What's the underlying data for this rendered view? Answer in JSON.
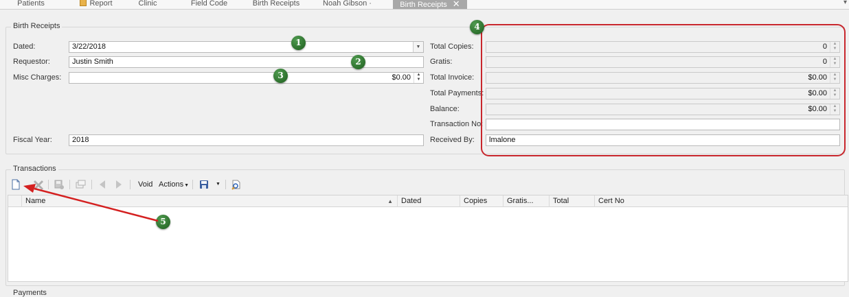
{
  "tabs": [
    {
      "label": "Patients",
      "icon": null,
      "active": false
    },
    {
      "label": "Report",
      "icon": "report-icon",
      "active": false
    },
    {
      "label": "Clinic",
      "icon": null,
      "active": false
    },
    {
      "label": "Field Code",
      "icon": null,
      "active": false
    },
    {
      "label": "Birth Receipts",
      "icon": null,
      "active": false
    },
    {
      "label": "Noah Gibson ·",
      "icon": null,
      "active": false
    },
    {
      "label": "Birth Receipts",
      "icon": null,
      "active": true
    }
  ],
  "receipt": {
    "group_title": "Birth Receipts",
    "dated_label": "Dated:",
    "dated_value": "3/22/2018",
    "requestor_label": "Requestor:",
    "requestor_value": "Justin Smith",
    "misc_label": "Misc Charges:",
    "misc_value": "$0.00",
    "fiscal_label": "Fiscal Year:",
    "fiscal_value": "2018",
    "total_copies_label": "Total Copies:",
    "total_copies_value": "0",
    "gratis_label": "Gratis:",
    "gratis_value": "0",
    "total_invoice_label": "Total Invoice:",
    "total_invoice_value": "$0.00",
    "total_payments_label": "Total Payments:",
    "total_payments_value": "$0.00",
    "balance_label": "Balance:",
    "balance_value": "$0.00",
    "transaction_no_label": "Transaction No:",
    "transaction_no_value": "",
    "received_by_label": "Received By:",
    "received_by_value": "lmalone"
  },
  "callouts": [
    "1",
    "2",
    "3",
    "4",
    "5"
  ],
  "transactions": {
    "group_title": "Transactions",
    "toolbar": {
      "void_label": "Void",
      "actions_label": "Actions"
    },
    "columns": [
      "Name",
      "Dated",
      "Copies",
      "Gratis...",
      "Total",
      "Cert No"
    ],
    "rows": []
  },
  "payments": {
    "group_title": "Payments"
  },
  "colors": {
    "callout_green": "#2e7d32",
    "highlight_red": "#c8262c",
    "arrow_red": "#d42020"
  }
}
